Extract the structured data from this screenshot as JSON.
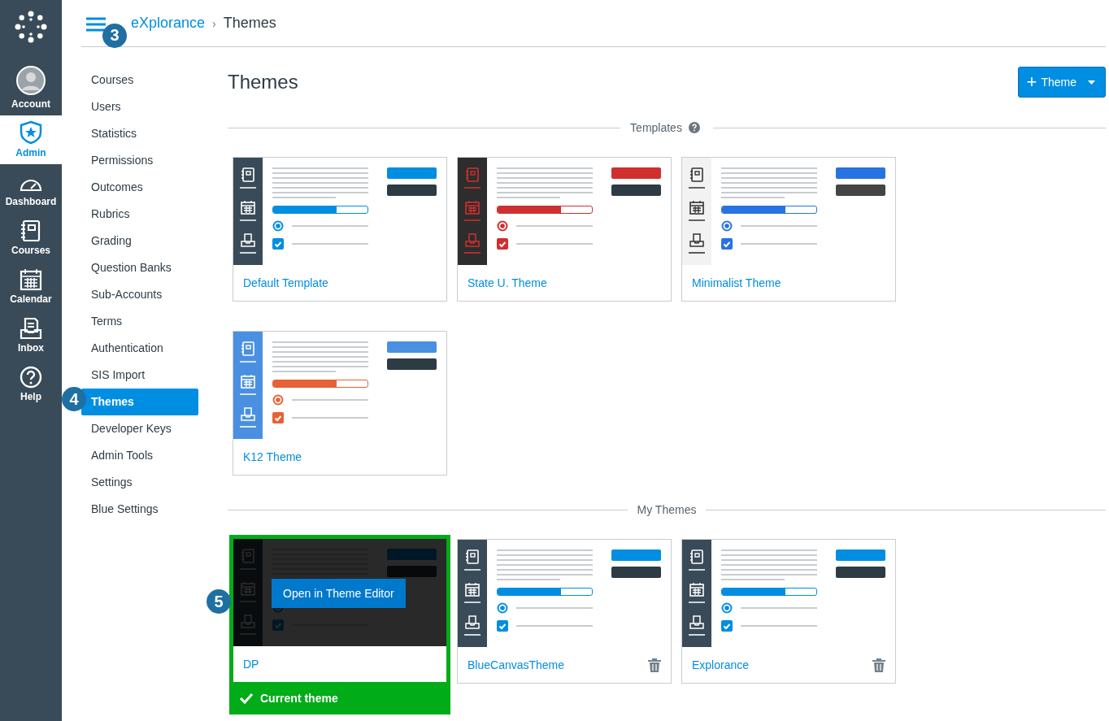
{
  "rail": [
    {
      "label": "Account",
      "kind": "avatar",
      "selected": false
    },
    {
      "label": "Admin",
      "kind": "shield",
      "selected": true
    },
    {
      "label": "Dashboard",
      "kind": "gauge",
      "selected": false
    },
    {
      "label": "Courses",
      "kind": "notebook",
      "selected": false
    },
    {
      "label": "Calendar",
      "kind": "calendar",
      "selected": false
    },
    {
      "label": "Inbox",
      "kind": "inbox",
      "selected": false
    },
    {
      "label": "Help",
      "kind": "help",
      "selected": false
    }
  ],
  "breadcrumb": {
    "root": "eXplorance",
    "separator": "›",
    "current": "Themes",
    "callout": "3"
  },
  "nav": [
    {
      "label": "Courses",
      "selected": false
    },
    {
      "label": "Users",
      "selected": false
    },
    {
      "label": "Statistics",
      "selected": false
    },
    {
      "label": "Permissions",
      "selected": false
    },
    {
      "label": "Outcomes",
      "selected": false
    },
    {
      "label": "Rubrics",
      "selected": false
    },
    {
      "label": "Grading",
      "selected": false
    },
    {
      "label": "Question Banks",
      "selected": false
    },
    {
      "label": "Sub-Accounts",
      "selected": false
    },
    {
      "label": "Terms",
      "selected": false
    },
    {
      "label": "Authentication",
      "selected": false
    },
    {
      "label": "SIS Import",
      "selected": false
    },
    {
      "label": "Themes",
      "selected": true,
      "callout": "4"
    },
    {
      "label": "Developer Keys",
      "selected": false
    },
    {
      "label": "Admin Tools",
      "selected": false
    },
    {
      "label": "Settings",
      "selected": false
    },
    {
      "label": "Blue Settings",
      "selected": false
    }
  ],
  "title": "Themes",
  "add_button": {
    "plus": "+",
    "label": "Theme"
  },
  "sections": [
    {
      "title": "Templates",
      "help": true,
      "themes": [
        {
          "name": "Default Template",
          "kind": "standard",
          "color": "#008ee2",
          "level": 0.67,
          "deletable": false,
          "current": false
        },
        {
          "name": "State U. Theme",
          "kind": "dark",
          "color": "#d12f2f",
          "level": 0.67,
          "deletable": false,
          "current": false
        },
        {
          "name": "Minimalist Theme",
          "kind": "minimal",
          "color": "#2773e2",
          "level": 0.67,
          "deletable": false,
          "current": false
        },
        {
          "name": "K12 Theme",
          "kind": "bright",
          "color": "#4a90e2",
          "level": 0.67,
          "deletable": false,
          "current": false
        }
      ]
    },
    {
      "title": "My Themes",
      "help": false,
      "themes": [
        {
          "name": "DP",
          "kind": "standard",
          "deletable": false,
          "current": true,
          "current_label": "Current theme",
          "hover_button": "Open in Theme Editor",
          "callout": "5"
        },
        {
          "name": "BlueCanvasTheme",
          "kind": "standard",
          "color": "#008ee2",
          "level": 0.67,
          "deletable": true,
          "current": false
        },
        {
          "name": "Explorance",
          "kind": "standard",
          "color": "#008ee2",
          "level": 0.67,
          "deletable": true,
          "current": false
        }
      ]
    }
  ]
}
